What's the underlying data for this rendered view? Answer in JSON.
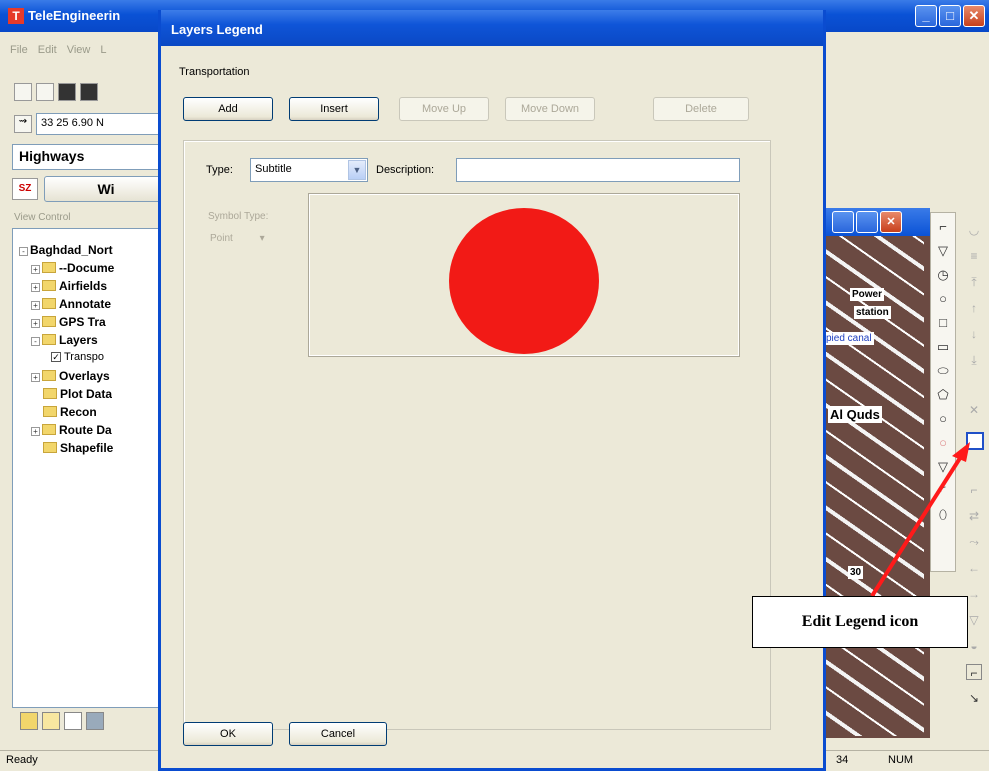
{
  "main_window": {
    "title": "TeleEngineerin",
    "menu": [
      "File",
      "Edit",
      "View",
      "L"
    ],
    "coord_text": "33 25  6.90 N",
    "layer_combo": "Highways",
    "wi_button": "Wi",
    "sz_icon": "SZ",
    "view_control_label": "View Control",
    "tree": [
      {
        "label": "Baghdad_Nort",
        "expand": "-",
        "folder": false
      },
      {
        "label": "--Docume",
        "expand": "+",
        "folder": true
      },
      {
        "label": "Airfields",
        "expand": "+",
        "folder": true
      },
      {
        "label": "Annotate",
        "expand": "+",
        "folder": true
      },
      {
        "label": "GPS Tra",
        "expand": "+",
        "folder": true
      },
      {
        "label": "Layers",
        "expand": "-",
        "folder": true
      },
      {
        "label": "Transpo",
        "expand": "",
        "folder": false,
        "checkbox": true
      },
      {
        "label": "Overlays",
        "expand": "+",
        "folder": true
      },
      {
        "label": "Plot Data",
        "expand": "",
        "folder": true
      },
      {
        "label": "Recon",
        "expand": "",
        "folder": true
      },
      {
        "label": "Route Da",
        "expand": "+",
        "folder": true
      },
      {
        "label": "Shapefile",
        "expand": "",
        "folder": true
      }
    ],
    "status": {
      "ready": "Ready",
      "num": "NUM",
      "coord_fragment": "34"
    }
  },
  "map": {
    "labels": [
      "Power",
      "station",
      "pied canal",
      "Al Quds",
      "30"
    ]
  },
  "dialog": {
    "title": "Layers Legend",
    "section": "Transportation",
    "buttons": {
      "add": "Add",
      "insert": "Insert",
      "move_up": "Move Up",
      "move_down": "Move Down",
      "delete": "Delete",
      "ok": "OK",
      "cancel": "Cancel"
    },
    "type_label": "Type:",
    "type_value": "Subtitle",
    "description_label": "Description:",
    "description_value": "",
    "symbol_label": "Symbol Type:",
    "symbol_value": "Point",
    "preview_color": "#f21a16"
  },
  "annotation": {
    "text": "Edit Legend icon",
    "arrow_color": "#ff1a1a"
  }
}
